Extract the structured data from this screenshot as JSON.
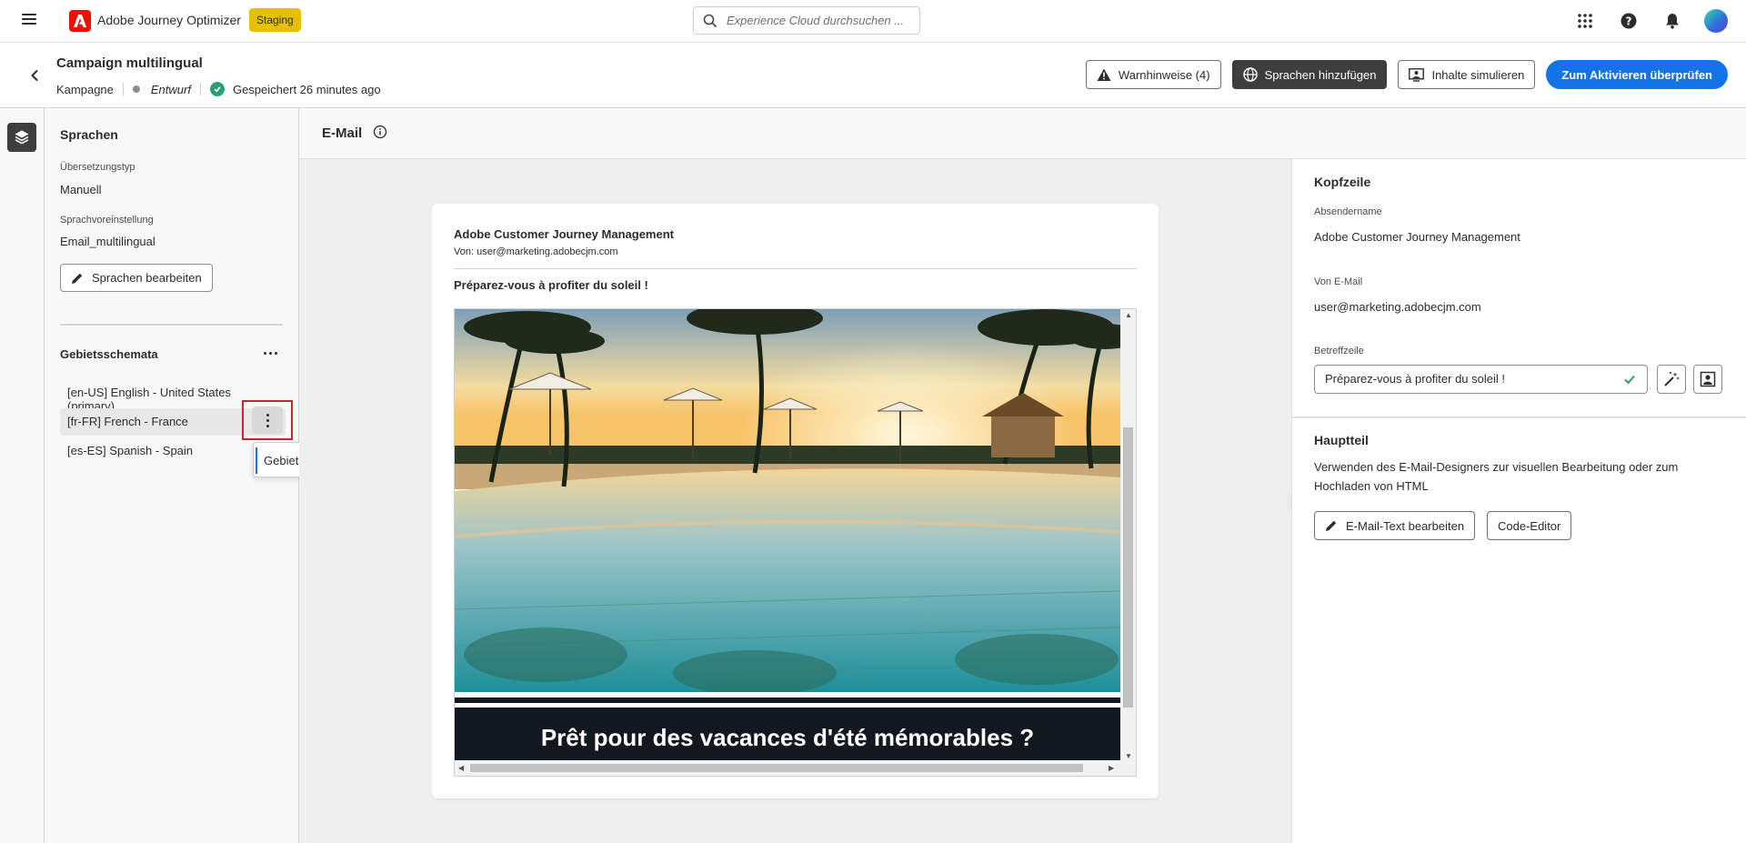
{
  "topbar": {
    "app_name": "Adobe Journey Optimizer",
    "env_badge": "Staging",
    "search_placeholder": "Experience Cloud durchsuchen ...",
    "icons": [
      "apps-grid-icon",
      "help-icon",
      "bell-icon",
      "avatar"
    ]
  },
  "campaign": {
    "title": "Campaign multilingual",
    "type": "Kampagne",
    "status": "Entwurf",
    "saved": "Gespeichert 26 minutes ago",
    "actions": {
      "warnings": "Warnhinweise (4)",
      "add_languages": "Sprachen hinzufügen",
      "simulate": "Inhalte simulieren",
      "review": "Zum Aktivieren überprüfen"
    }
  },
  "languages_panel": {
    "title": "Sprachen",
    "translation_type_label": "Übersetzungstyp",
    "translation_type_value": "Manuell",
    "language_setting_label": "Sprachvoreinstellung",
    "language_setting_value": "Email_multilingual",
    "edit_button": "Sprachen bearbeiten",
    "locales_title": "Gebietsschemata",
    "locales": [
      "[en-US] English - United States (primary)",
      "[fr-FR] French - France",
      "[es-ES] Spanish - Spain"
    ],
    "popover_item": "Gebietssche..."
  },
  "email": {
    "section_title": "E-Mail",
    "preview": {
      "sender": "Adobe Customer Journey Management",
      "from": "Von: user@marketing.adobecjm.com",
      "subject": "Préparez-vous à profiter du soleil !",
      "banner_title": "Prêt pour des vacances d'été mémorables ?"
    }
  },
  "header_panel": {
    "title": "Kopfzeile",
    "sender_name_label": "Absendername",
    "sender_name_value": "Adobe Customer Journey Management",
    "from_email_label": "Von E-Mail",
    "from_email_value": "user@marketing.adobecjm.com",
    "subject_label": "Betreffzeile",
    "subject_value": "Préparez-vous à profiter du soleil !"
  },
  "body_panel": {
    "title": "Hauptteil",
    "description": "Verwenden des E-Mail-Designers zur visuellen Bearbeitung oder zum Hochladen von HTML",
    "edit_button": "E-Mail-Text bearbeiten",
    "code_button": "Code-Editor"
  },
  "colors": {
    "accent": "#1473e6",
    "brand": "#eb1000",
    "badge": "#e6c000",
    "success": "#2d9d78",
    "highlight_border": "#c9252c"
  }
}
